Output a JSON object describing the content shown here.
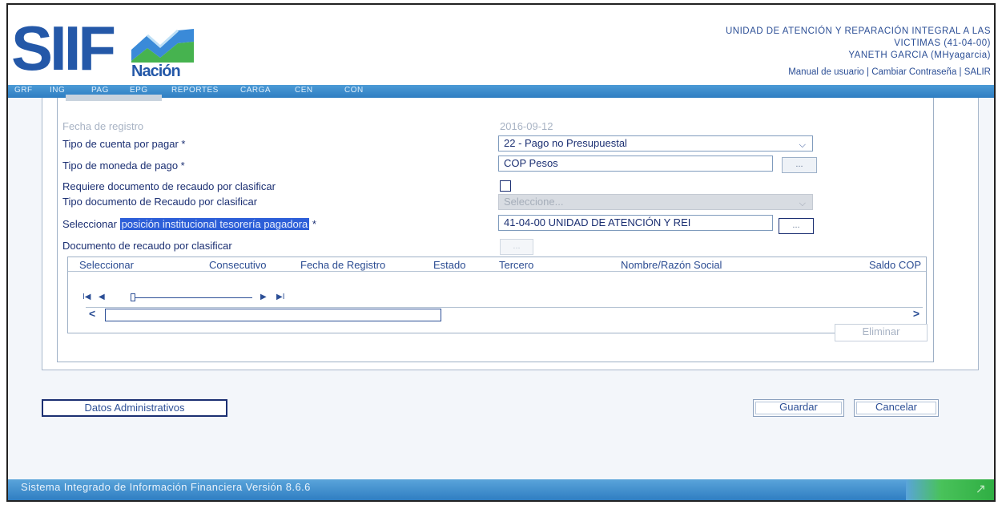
{
  "header": {
    "logo_text": "SIIF",
    "logo_subtext": "Nación",
    "entity_line1": "UNIDAD DE ATENCIÓN Y REPARACIÓN INTEGRAL A LAS",
    "entity_line2": "VICTIMAS (41-04-00)",
    "user": "YANETH GARCIA (MHyagarcia)",
    "link_manual": "Manual de usuario",
    "link_password": "Cambiar Contraseña",
    "link_exit": "SALIR",
    "separator": "|"
  },
  "menu": [
    "GRF",
    "ING",
    "PAG",
    "EPG",
    "REPORTES",
    "CARGA",
    "CEN",
    "CON"
  ],
  "form": {
    "fecha_label": "Fecha de registro",
    "fecha_value": "2016-09-12",
    "tipo_cuenta_label": "Tipo de cuenta por pagar *",
    "tipo_cuenta_value": "22 - Pago no Presupuestal",
    "tipo_moneda_label": "Tipo de moneda de pago *",
    "tipo_moneda_value": "COP Pesos",
    "requiere_label": "Requiere documento de recaudo por clasificar",
    "tipo_doc_label": "Tipo documento de Recaudo por clasificar",
    "tipo_doc_value": "Seleccione...",
    "seleccionar_label": "Seleccionar",
    "seleccionar_highlight": "posición institucional tesorería pagadora",
    "seleccionar_suffix": "*",
    "posicion_value": "41-04-00 UNIDAD DE ATENCIÓN Y REI",
    "documento_label": "Documento de recaudo por clasificar",
    "ellipsis": "..."
  },
  "table": {
    "headers": [
      "Seleccionar",
      "Consecutivo",
      "Fecha de Registro",
      "Estado",
      "Tercero",
      "Nombre/Razón Social",
      "Saldo COP"
    ],
    "pager_first": "I◀",
    "pager_prev": "◀",
    "pager_next": "▶",
    "pager_last": "▶I",
    "scroll_left": "<",
    "scroll_right": ">"
  },
  "buttons": {
    "eliminar": "Eliminar",
    "datos_admin": "Datos Administrativos",
    "guardar": "Guardar",
    "cancelar": "Cancelar"
  },
  "footer": {
    "text": "Sistema Integrado de Información Financiera Versión 8.6.6"
  },
  "colors": {
    "menu_bar": "#2f7ec2",
    "brand_blue": "#2458a8",
    "highlight": "#2d5fd8",
    "footer_green": "#2fae43"
  }
}
